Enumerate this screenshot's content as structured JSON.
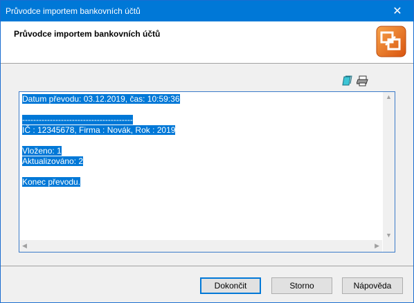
{
  "window": {
    "title": "Průvodce importem bankovních účtů",
    "close_symbol": "✕"
  },
  "header": {
    "title": "Průvodce importem bankovních účtů",
    "logo_icon": "wizard-logo-icon"
  },
  "toolbar": {
    "copy_icon": "copy-icon",
    "print_icon": "print-icon"
  },
  "log": {
    "lines": [
      "Datum převodu: 03.12.2019, čas: 10:59:36",
      "",
      "----------------------------------------",
      "IČ : 12345678, Firma : Novák, Rok : 2019",
      "",
      "Vloženo: 1",
      "Aktualizováno: 2",
      "",
      "Konec převodu."
    ]
  },
  "buttons": {
    "finish": "Dokončit",
    "cancel": "Storno",
    "help": "Nápověda"
  },
  "colors": {
    "titlebar": "#0078d7",
    "selection": "#0078d7",
    "logo_orange": "#e8731a"
  }
}
